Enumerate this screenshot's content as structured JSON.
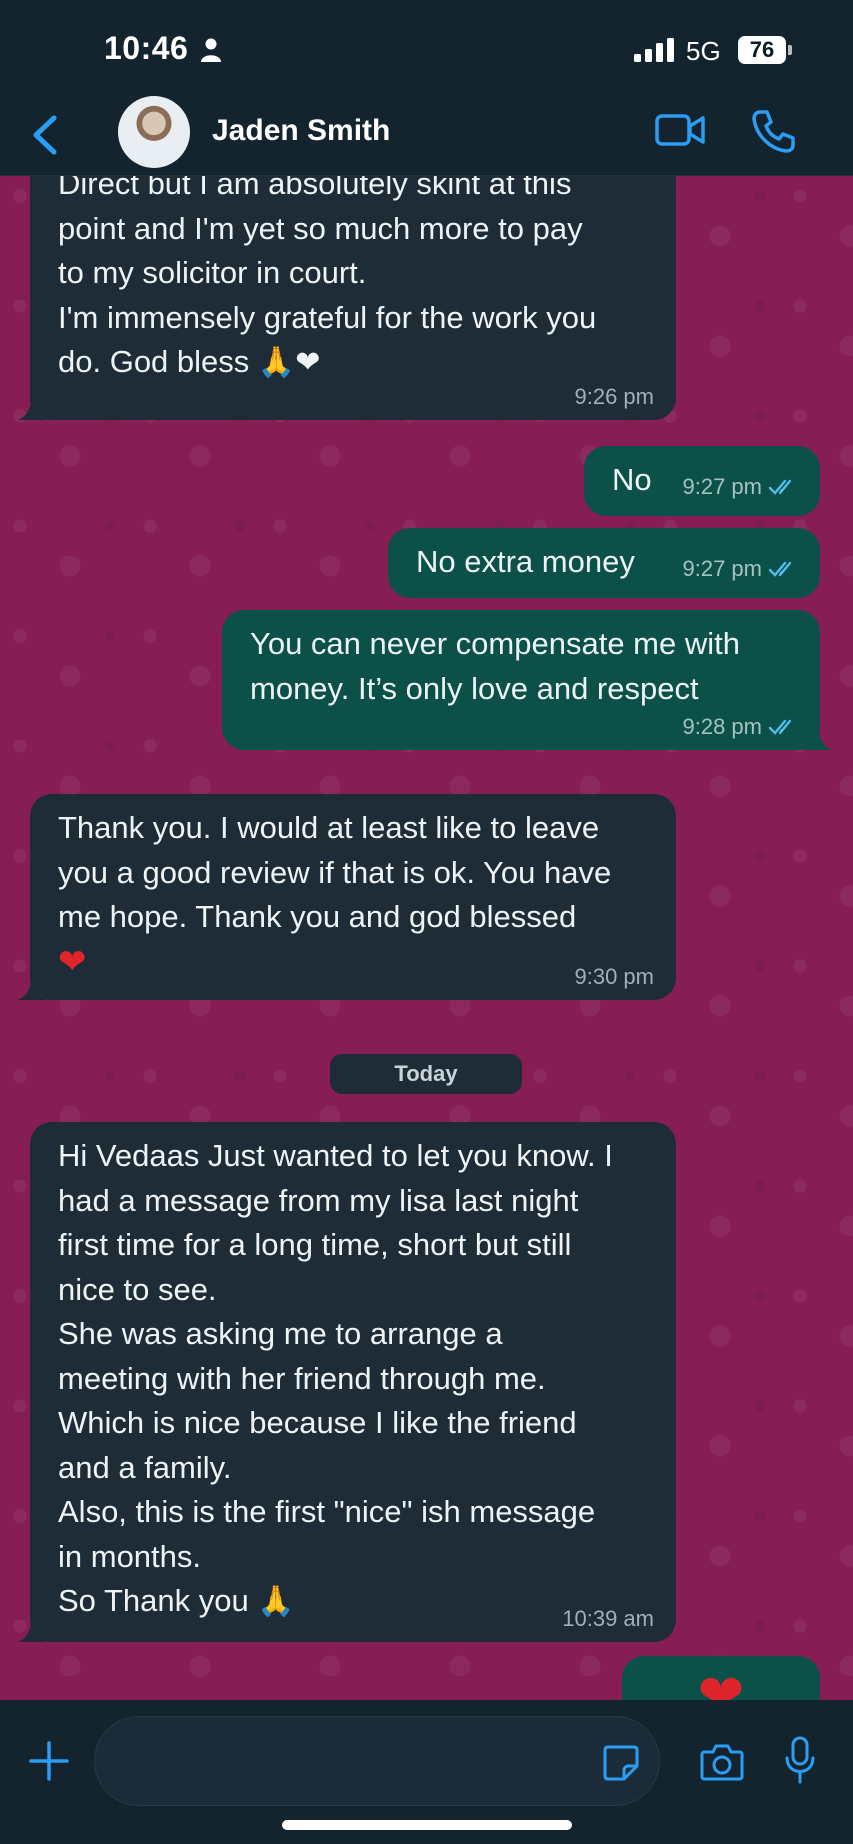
{
  "status_bar": {
    "time": "10:46",
    "network": "5G",
    "battery": "76"
  },
  "header": {
    "contact_name": "Jaden Smith",
    "icons": [
      "chevron-left-icon",
      "video-camera-icon",
      "phone-icon"
    ]
  },
  "messages": [
    {
      "direction": "incoming",
      "text": "Direct but I am absolutely skint at this\npoint and I'm yet so much more to pay\nto my solicitor in court.\nI'm immensely grateful for the work you\ndo. God bless",
      "emojis": "🙏❤",
      "time": "9:26 pm"
    },
    {
      "direction": "outgoing",
      "text": "No",
      "time": "9:27 pm",
      "status": "read"
    },
    {
      "direction": "outgoing",
      "text": "No extra money",
      "time": "9:27 pm",
      "status": "read"
    },
    {
      "direction": "outgoing",
      "text": "You can never compensate me with\nmoney. It’s only love and respect",
      "time": "9:28 pm",
      "status": "read"
    },
    {
      "direction": "incoming",
      "text": "Thank you. I would at least like to leave\nyou a good review if that is ok. You have\nme hope. Thank you and god blessed",
      "emojis": "❤",
      "time": "9:30 pm"
    },
    {
      "direction": "incoming",
      "text": "Hi Vedaas Just wanted to let you know. I\nhad a message from my lisa  last night\nfirst time for a long time, short but still\nnice to see.\nShe was asking me to arrange a\nmeeting with her friend through me.\nWhich is nice because I like the friend\nand a family.\nAlso, this is the first \"nice\" ish message\nin months.\nSo Thank you",
      "emojis": "🙏",
      "time": "10:39 am"
    },
    {
      "direction": "outgoing",
      "emojis": "❤"
    }
  ],
  "date_divider": "Today",
  "input": {
    "value": "",
    "placeholder": ""
  },
  "colors": {
    "chat_background": "#861e55",
    "incoming_bubble": "#1d2c36",
    "outgoing_bubble": "#0b5049",
    "accent": "#2a9df4",
    "bars": "#13242f"
  }
}
